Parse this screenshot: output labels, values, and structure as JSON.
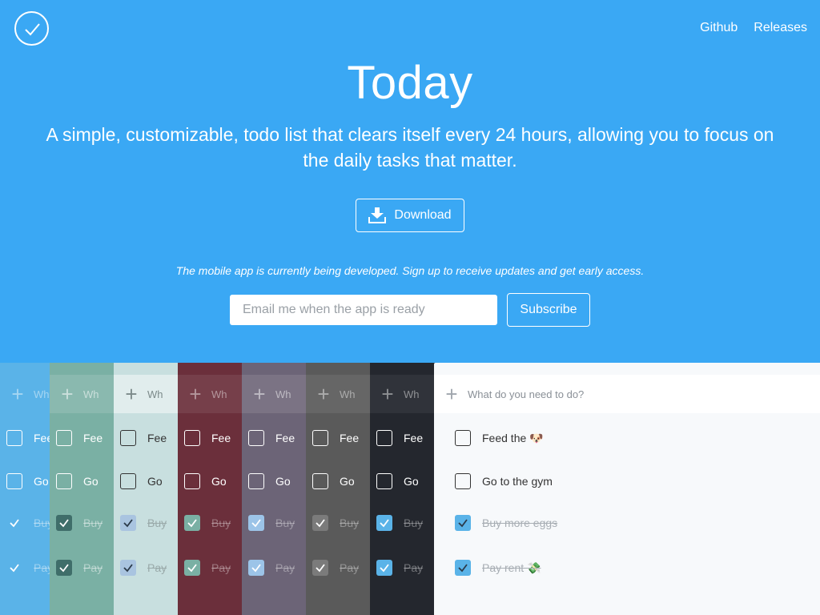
{
  "header": {
    "logo": "check-circle-icon",
    "nav": [
      "Github",
      "Releases"
    ]
  },
  "hero": {
    "title": "Today",
    "subtitle": "A simple, customizable, todo list that clears itself every 24 hours, allowing you to focus on the daily tasks that matter.",
    "download_label": "Download"
  },
  "signup": {
    "note": "The mobile app is currently being developed. Sign up to receive updates and get early access.",
    "placeholder": "Email me when the app is ready",
    "button_label": "Subscribe"
  },
  "preview": {
    "themes": [
      {
        "add_text": "Wh",
        "items": [
          "Fee",
          "Go",
          "Buy",
          "Pay"
        ]
      },
      {
        "add_text": "Wh",
        "items": [
          "Fee",
          "Go",
          "Buy",
          "Pay"
        ]
      },
      {
        "add_text": "Wh",
        "items": [
          "Fee",
          "Go",
          "Buy",
          "Pay"
        ]
      },
      {
        "add_text": "Wh",
        "items": [
          "Fee",
          "Go",
          "Buy",
          "Pay"
        ]
      },
      {
        "add_text": "Wh",
        "items": [
          "Fee",
          "Go",
          "Buy",
          "Pay"
        ]
      },
      {
        "add_text": "Wh",
        "items": [
          "Fee",
          "Go",
          "Buy",
          "Pay"
        ]
      },
      {
        "add_text": "Wh",
        "items": [
          "Fee",
          "Go",
          "Buy",
          "Pay"
        ]
      },
      {
        "add_text": "What do you need to do?",
        "items": [
          "Feed the 🐶",
          "Go to the gym",
          "Buy more eggs",
          "Pay rent 💸"
        ]
      }
    ],
    "done": [
      false,
      false,
      true,
      true
    ]
  }
}
